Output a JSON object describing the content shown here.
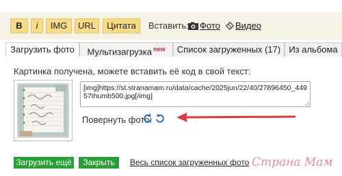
{
  "toolbar": {
    "bold_label": "B",
    "italic_label": "i",
    "img_label": "IMG",
    "url_label": "URL",
    "quote_label": "Цитата",
    "insert_label": "Вставить:",
    "photo_label": "Фото",
    "video_label": "Видео",
    "button_color": "#f6dc86"
  },
  "tabs": [
    {
      "label": "Загрузить фото",
      "active": true
    },
    {
      "label": "Мультизагрузка",
      "badge": "new"
    },
    {
      "label": "Список загруженных (17)"
    },
    {
      "label": "Из альбома"
    }
  ],
  "panel": {
    "message": "Картинка получена, можете вставить её код в свой текст:",
    "code_value": "[img]https://st.stranamam.ru/data/cache/2025jun/22/40/27896450_44957thumb500.jpg[/img]",
    "rotate_label": "Повернуть фото:",
    "rotate_left_icon": "rotate-left-icon",
    "rotate_right_icon": "rotate-right-icon",
    "arrow_color": "#d83a3a",
    "icon_color": "#2a6ebd"
  },
  "actions": {
    "upload_more": "Загрузить ещё",
    "close": "Закрыть",
    "all_uploaded": "Весь список загруженных фото",
    "green_color": "#27a036"
  },
  "watermark": {
    "text": "Страна Мам",
    "color": "#e28ea0"
  }
}
